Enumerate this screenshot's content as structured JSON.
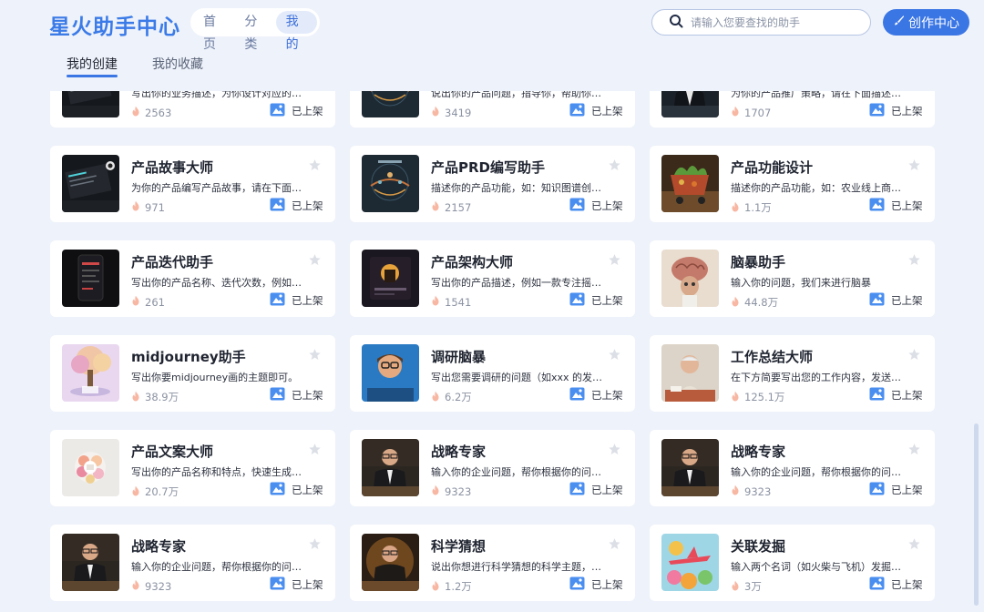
{
  "app": {
    "logo": "星火助手中心"
  },
  "nav": [
    {
      "label": "首页",
      "active": false
    },
    {
      "label": "分类",
      "active": false
    },
    {
      "label": "我的",
      "active": true
    }
  ],
  "search": {
    "placeholder": "请输入您要查找的助手"
  },
  "create_button": "创作中心",
  "tabs": [
    {
      "label": "我的创建",
      "active": true
    },
    {
      "label": "我的收藏",
      "active": false
    }
  ],
  "cards": [
    {
      "title": "",
      "desc": "写出你的业务描述，为你设计对应的业...",
      "count": "2563",
      "status": "已上架",
      "thumb": "dark-laptop"
    },
    {
      "title": "",
      "desc": "说出你的产品问题，指导你，帮助你成...",
      "count": "3419",
      "status": "已上架",
      "thumb": "dark-pattern"
    },
    {
      "title": "",
      "desc": "为你的产品推广策略，请在下面描述你...",
      "count": "1707",
      "status": "已上架",
      "thumb": "dark-suit"
    },
    {
      "title": "产品故事大师",
      "desc": "为你的产品编写产品故事，请在下面写...",
      "count": "971",
      "status": "已上架",
      "thumb": "dark-laptop"
    },
    {
      "title": "产品PRD编写助手",
      "desc": "描述你的产品功能，如：知识图谱创建...",
      "count": "2157",
      "status": "已上架",
      "thumb": "dark-pattern"
    },
    {
      "title": "产品功能设计",
      "desc": "描述你的产品功能，如：农业线上商城...",
      "count": "1.1万",
      "status": "已上架",
      "thumb": "cart"
    },
    {
      "title": "产品迭代助手",
      "desc": "写出你的产品名称、迭代次数，例如说...",
      "count": "261",
      "status": "已上架",
      "thumb": "dark-phone"
    },
    {
      "title": "产品架构大师",
      "desc": "写出你的产品描述，例如一款专注摇滚...",
      "count": "1541",
      "status": "已上架",
      "thumb": "rock-app"
    },
    {
      "title": "脑暴助手",
      "desc": "输入你的问题，我们来进行脑暴",
      "count": "44.8万",
      "status": "已上架",
      "thumb": "brain"
    },
    {
      "title": "midjourney助手",
      "desc": "写出你要midjourney画的主题即可。",
      "count": "38.9万",
      "status": "已上架",
      "thumb": "fantasy-tree"
    },
    {
      "title": "调研脑暴",
      "desc": "写出您需要调研的问题（如xxx 的发展...",
      "count": "6.2万",
      "status": "已上架",
      "thumb": "cartoon-boy"
    },
    {
      "title": "工作总结大师",
      "desc": "在下方简要写出您的工作内容，发送即可",
      "count": "125.1万",
      "status": "已上架",
      "thumb": "old-man"
    },
    {
      "title": "产品文案大师",
      "desc": "写出你的产品名称和特点，快速生成产...",
      "count": "20.7万",
      "status": "已上架",
      "thumb": "flower"
    },
    {
      "title": "战略专家",
      "desc": "输入你的企业问题，帮你根据你的问题...",
      "count": "9323",
      "status": "已上架",
      "thumb": "suit-man"
    },
    {
      "title": "战略专家",
      "desc": "输入你的企业问题，帮你根据你的问题...",
      "count": "9323",
      "status": "已上架",
      "thumb": "suit-man"
    },
    {
      "title": "战略专家",
      "desc": "输入你的企业问题，帮你根据你的问题...",
      "count": "9323",
      "status": "已上架",
      "thumb": "suit-man"
    },
    {
      "title": "科学猜想",
      "desc": "说出你想进行科学猜想的科学主题，让...",
      "count": "1.2万",
      "status": "已上架",
      "thumb": "scientist"
    },
    {
      "title": "关联发掘",
      "desc": "输入两个名词（如火柴与飞机）发掘他...",
      "count": "3万",
      "status": "已上架",
      "thumb": "plane-art"
    }
  ],
  "colors": {
    "accent": "#3b76e5",
    "page_bg": "#eef2fa",
    "card_bg": "#ffffff"
  }
}
